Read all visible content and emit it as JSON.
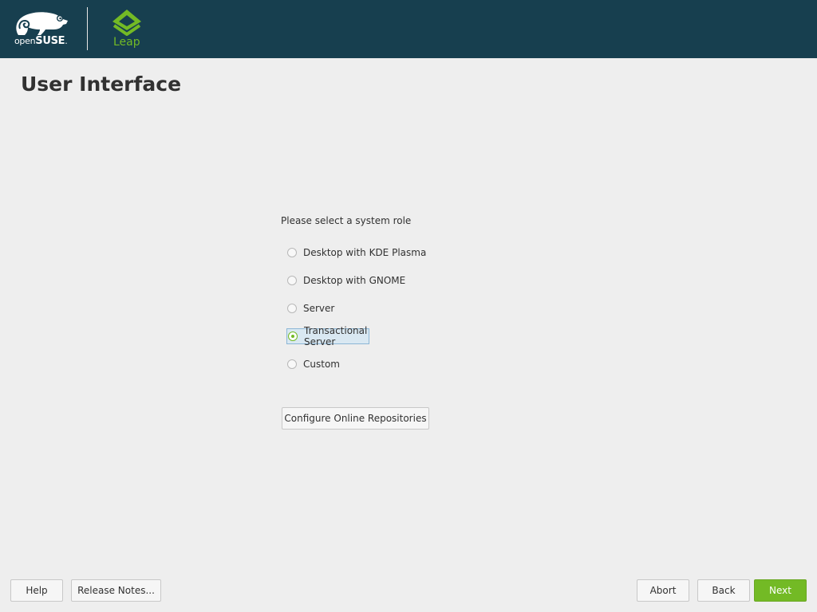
{
  "header": {
    "brand": {
      "prefix": "open",
      "name": "SUSE",
      "mark": "."
    },
    "product": "Leap"
  },
  "page": {
    "title": "User Interface"
  },
  "role_selection": {
    "prompt": "Please select a system role",
    "options": [
      {
        "label": "Desktop with KDE Plasma",
        "checked": false
      },
      {
        "label": "Desktop with GNOME",
        "checked": false
      },
      {
        "label": "Server",
        "checked": false
      },
      {
        "label": "Transactional Server",
        "checked": true
      },
      {
        "label": "Custom",
        "checked": false
      }
    ]
  },
  "configure_button": "Configure Online Repositories",
  "footer": {
    "help": "Help",
    "release_notes": "Release Notes...",
    "abort": "Abort",
    "back": "Back",
    "next": "Next"
  },
  "colors": {
    "header_bg": "#173f4f",
    "accent_green": "#73ba25",
    "page_bg": "#eeeeee",
    "selection": "#d9e8f2"
  },
  "icons": [
    "opensuse-chameleon-icon",
    "leap-logo-icon",
    "radio-icon"
  ]
}
